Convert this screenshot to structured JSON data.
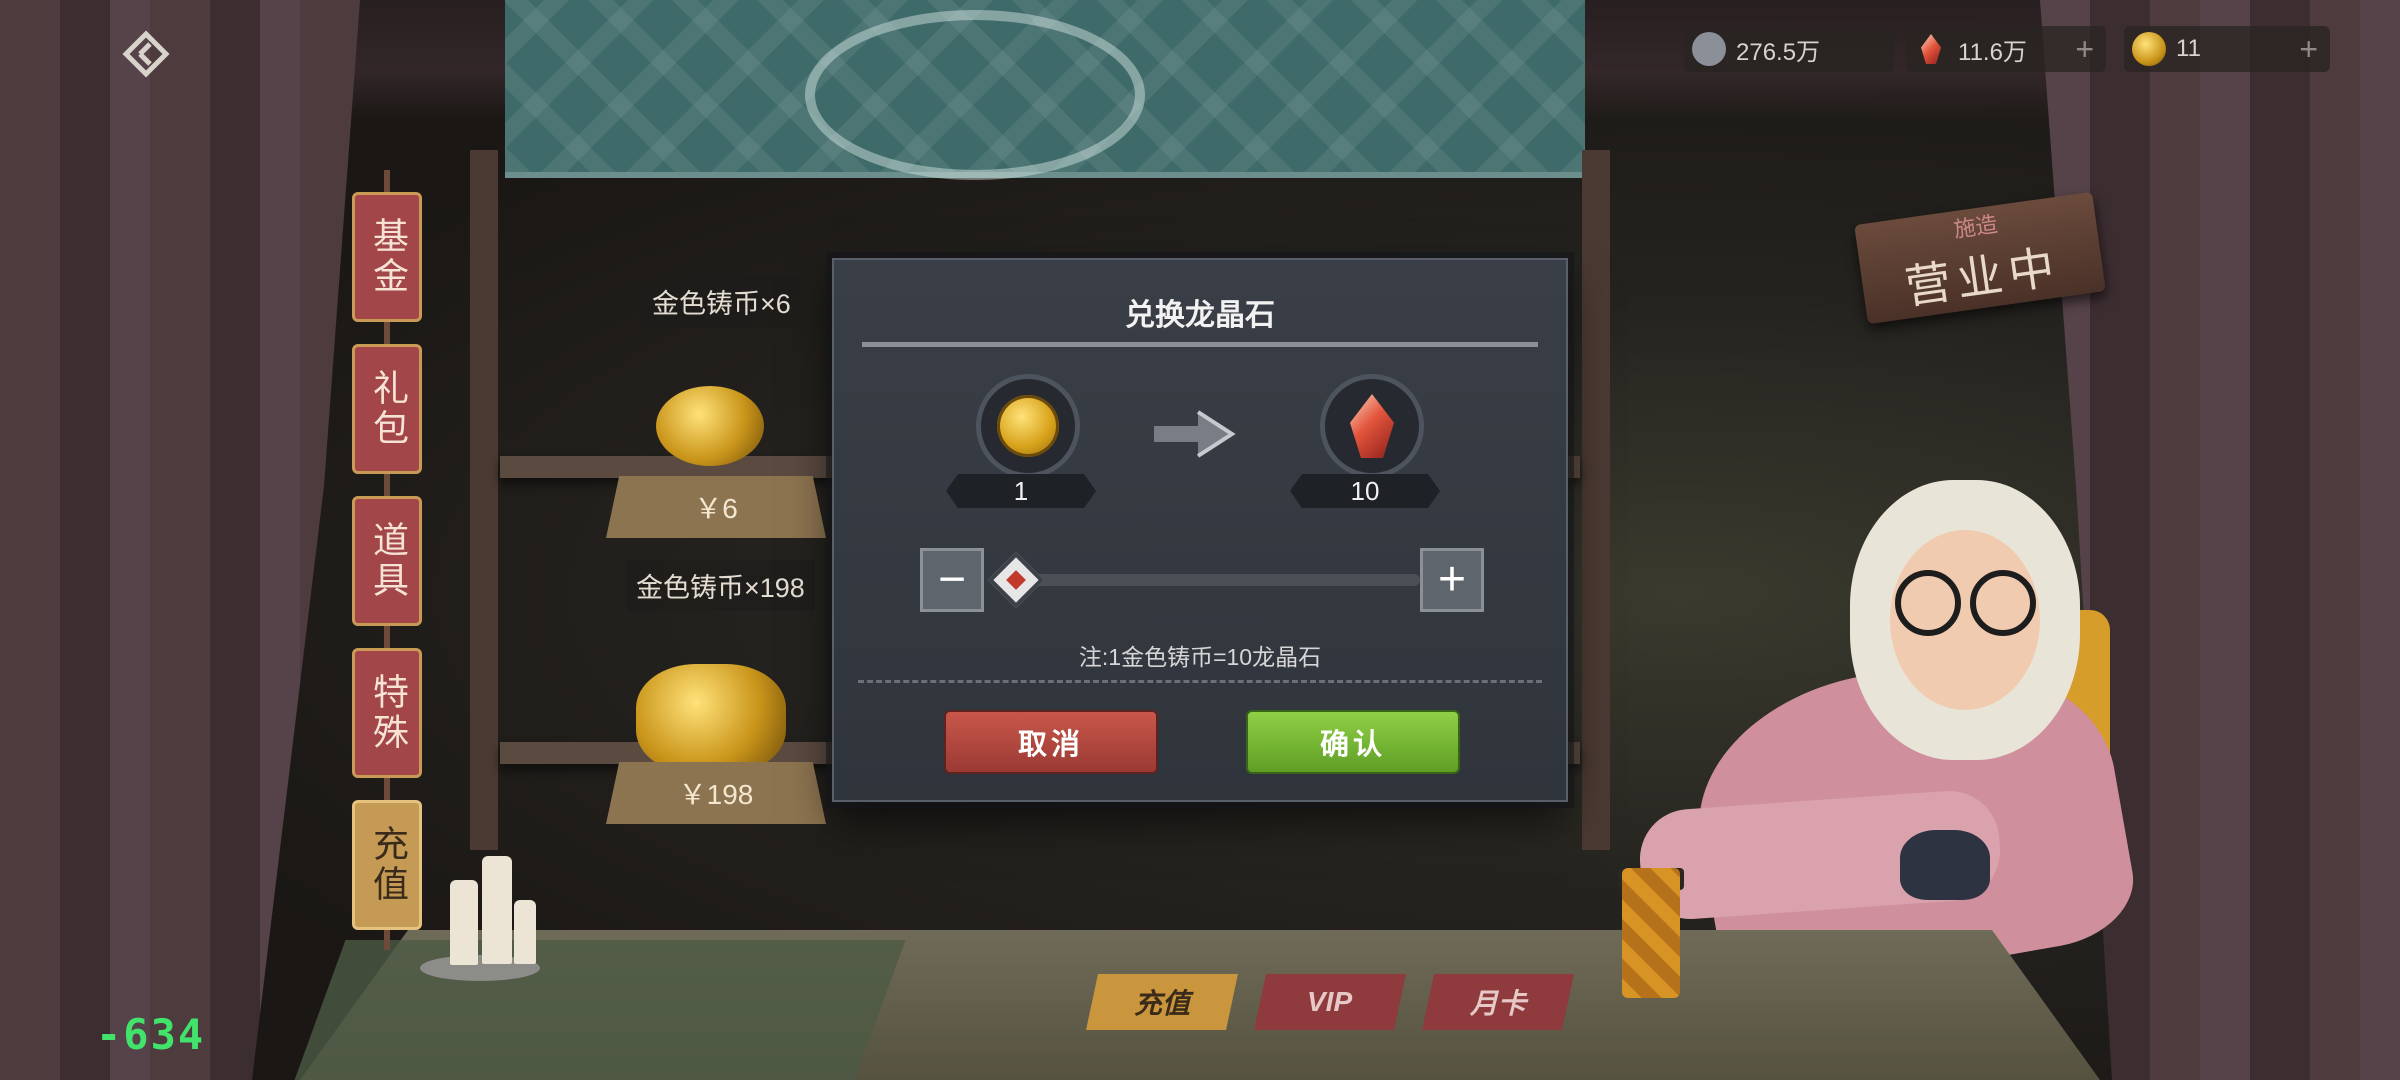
{
  "currencies": [
    {
      "icon": "silver-coin-icon",
      "value": "276.5万",
      "has_plus": false
    },
    {
      "icon": "dragon-crystal-icon",
      "value": "11.6万",
      "has_plus": true
    },
    {
      "icon": "gold-coin-icon",
      "value": "11",
      "has_plus": true
    }
  ],
  "side_tabs": [
    {
      "label": "基金",
      "active": false
    },
    {
      "label": "礼包",
      "active": false
    },
    {
      "label": "道具",
      "active": false
    },
    {
      "label": "特殊",
      "active": false
    },
    {
      "label": "充值",
      "active": true
    }
  ],
  "products": [
    {
      "name": "金色铸币×6",
      "price": "￥6"
    },
    {
      "name": "金色铸币×198",
      "price": "￥198"
    }
  ],
  "sign": {
    "small": "施造",
    "big": "营业中"
  },
  "bottom_tabs": [
    {
      "label": "充值",
      "active": true
    },
    {
      "label": "VIP",
      "active": false
    },
    {
      "label": "月卡",
      "active": false
    }
  ],
  "fps_counter": "-634",
  "dialog": {
    "title": "兑换龙晶石",
    "from": {
      "icon": "gold-coin-icon",
      "amount": "1"
    },
    "to": {
      "icon": "dragon-crystal-icon",
      "amount": "10"
    },
    "slider_fraction": 0.0,
    "minus_label": "−",
    "plus_label": "+",
    "note": "注:1金色铸币=10龙晶石",
    "cancel_label": "取消",
    "confirm_label": "确认"
  },
  "colors": {
    "cancel": "#b04840",
    "confirm": "#7dbd35",
    "tab_active": "#c59a55",
    "tab_inactive": "#a2464a",
    "fps": "#41e36b"
  }
}
